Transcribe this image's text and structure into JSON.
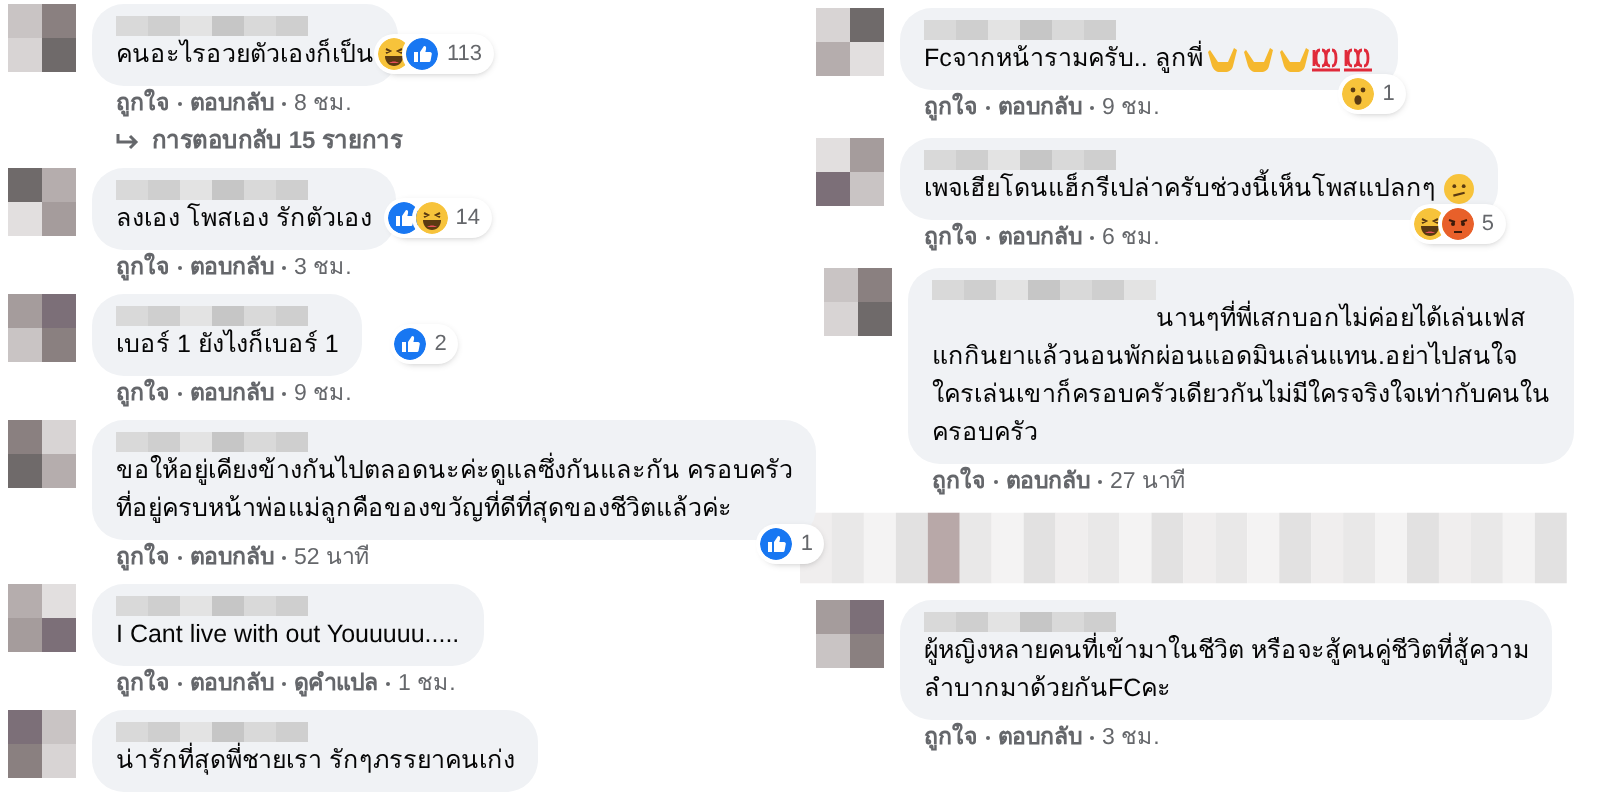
{
  "columns": [
    {
      "comments": [
        {
          "lines": [
            "คนอะไรอวยตัวเองก็เป็น"
          ],
          "reactions": [
            {
              "kind": "haha"
            },
            {
              "kind": "like"
            }
          ],
          "reaction_count": "113",
          "actions": [
            "ถูกใจ",
            "ตอบกลับ"
          ],
          "time": "8 ชม.",
          "replies": "การตอบกลับ 15 รายการ"
        },
        {
          "lines": [
            "ลงเอง โพสเอง รักตัวเอง"
          ],
          "reactions": [
            {
              "kind": "like"
            },
            {
              "kind": "haha"
            }
          ],
          "reaction_count": "14",
          "actions": [
            "ถูกใจ",
            "ตอบกลับ"
          ],
          "time": "3 ชม."
        },
        {
          "lines": [
            "เบอร์ 1 ยังไงก็เบอร์ 1"
          ],
          "reactions": [
            {
              "kind": "like"
            }
          ],
          "reaction_count": "2",
          "actions": [
            "ถูกใจ",
            "ตอบกลับ"
          ],
          "time": "9 ชม."
        },
        {
          "lines": [
            "ขอให้อยู่เคียงข้างกันไปตลอดนะค่ะดูแลซึ่งกันและกัน ครอบครัว",
            "ที่อยู่ครบหน้าพ่อแม่ลูกคือของขวัญที่ดีที่สุดของชีวิตแล้วค่ะ"
          ],
          "reactions": [
            {
              "kind": "like"
            }
          ],
          "reaction_count": "1",
          "actions": [
            "ถูกใจ",
            "ตอบกลับ"
          ],
          "time": "52 นาที"
        },
        {
          "lines": [
            "I Cant live with out Youuuuu....."
          ],
          "actions": [
            "ถูกใจ",
            "ตอบกลับ",
            "ดูคำแปล"
          ],
          "time": "1 ชม."
        },
        {
          "lines": [
            "น่ารักที่สุดพี่ชายเรา รักๆภรรยาคนเก่ง"
          ]
        }
      ]
    },
    {
      "comments": [
        {
          "lines": [
            "Fcจากหน้ารามครับ.. ลูกพี่"
          ],
          "emojis": [
            {
              "kind": "rock"
            },
            {
              "kind": "rock"
            },
            {
              "kind": "rock"
            },
            {
              "kind": "hundred"
            },
            {
              "kind": "hundred"
            }
          ],
          "reactions": [
            {
              "kind": "wow"
            }
          ],
          "reaction_count": "1",
          "actions": [
            "ถูกใจ",
            "ตอบกลับ"
          ],
          "time": "9 ชม."
        },
        {
          "lines": [
            "เพจเฮียโดนแฮ็กรีเปล่าครับช่วงนี้เห็นโพสแปลกๆ"
          ],
          "emojis": [
            {
              "kind": "confused"
            }
          ],
          "reactions": [
            {
              "kind": "haha"
            },
            {
              "kind": "angry"
            }
          ],
          "reaction_count": "5",
          "actions": [
            "ถูกใจ",
            "ตอบกลับ"
          ],
          "time": "6 ชม."
        },
        {
          "kind": "reply",
          "lines": [
            "นานๆที่พี่เสกบอกไม่ค่อยได้เล่นเฟส",
            "แกกินยาแล้วนอนพักผ่อนแอดมินเล่นแทน.อย่าไปสนใจ",
            "ใครเล่นเขาก็ครอบครัวเดียวกันไม่มีใครจริงใจเท่ากับคนใน",
            "ครอบครัว"
          ],
          "actions": [
            "ถูกใจ",
            "ตอบกลับ"
          ],
          "time": "27 นาที"
        },
        {
          "kind": "hidden"
        },
        {
          "lines": [
            "ผู้หญิงหลายคนที่เข้ามาในชีวิต หรือจะสู้คนคู่ชีวิตที่สู้ความ",
            "ลำบากมาด้วยกันFCคะ"
          ],
          "actions": [
            "ถูกใจ",
            "ตอบกลับ"
          ],
          "time": "3 ชม."
        }
      ]
    }
  ]
}
